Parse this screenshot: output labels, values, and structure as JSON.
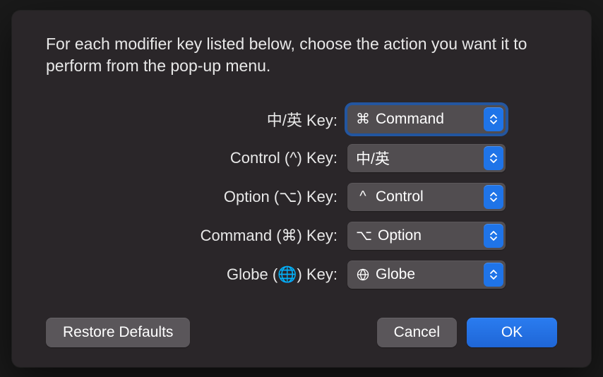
{
  "description": "For each modifier key listed below, choose the action you want it to perform from the pop-up menu.",
  "rows": [
    {
      "label": "中/英 Key:",
      "icon": "⌘",
      "value": "Command",
      "focused": true,
      "iconName": "command-icon"
    },
    {
      "label": "Control (^) Key:",
      "icon": "",
      "value": "中/英",
      "focused": false,
      "iconName": "ime-icon"
    },
    {
      "label": "Option (⌥) Key:",
      "icon": "^",
      "value": "Control",
      "focused": false,
      "iconName": "control-icon"
    },
    {
      "label": "Command (⌘) Key:",
      "icon": "⌥",
      "value": "Option",
      "focused": false,
      "iconName": "option-icon"
    },
    {
      "label": "Globe (🌐) Key:",
      "icon": "globe",
      "value": "Globe",
      "focused": false,
      "iconName": "globe-icon"
    }
  ],
  "buttons": {
    "restore": "Restore Defaults",
    "cancel": "Cancel",
    "ok": "OK"
  }
}
